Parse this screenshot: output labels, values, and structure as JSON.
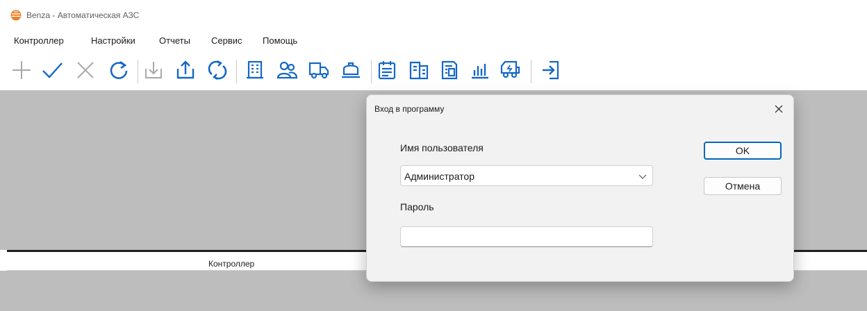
{
  "window": {
    "title": "Benza - Автоматическая АЗС",
    "icon": "benza-logo-icon",
    "icon_color": "#f07a1a"
  },
  "menu": [
    {
      "label": "Контроллер"
    },
    {
      "label": "Настройки"
    },
    {
      "label": "Отчеты"
    },
    {
      "label": "Сервис"
    },
    {
      "label": "Помощь"
    }
  ],
  "toolbar": {
    "icons": [
      "plus-icon",
      "check-icon",
      "close-icon",
      "refresh-icon",
      "download-icon",
      "upload-icon",
      "sync-icon",
      "building-icon",
      "users-icon",
      "truck-icon",
      "tank-icon",
      "calendar-icon",
      "document-icon",
      "card-icon",
      "chart-icon",
      "fuel-truck-icon",
      "exit-icon"
    ],
    "disabled_color": "#a8a8a8",
    "active_color": "#1468c4"
  },
  "panel": {
    "header": "Контроллер"
  },
  "login_dialog": {
    "title": "Вход в программу",
    "username_label": "Имя пользователя",
    "username_value": "Администратор",
    "password_label": "Пароль",
    "password_value": "",
    "ok_label": "OK",
    "cancel_label": "Отмена",
    "accent_color": "#0067c0"
  }
}
